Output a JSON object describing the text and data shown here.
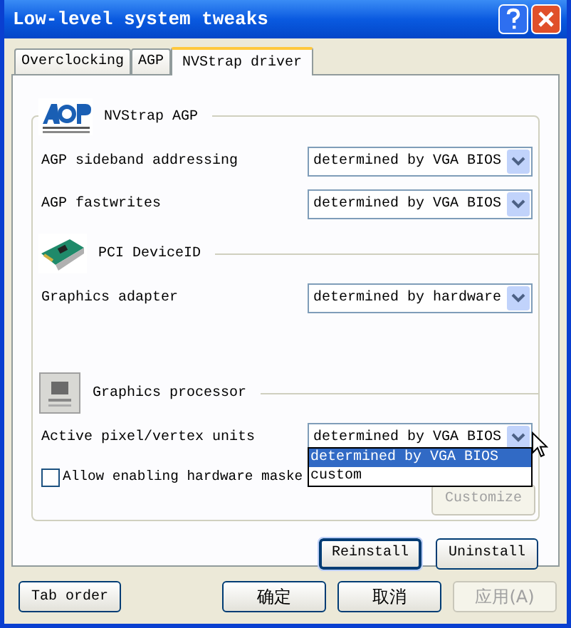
{
  "window": {
    "title": "Low-level system tweaks"
  },
  "tabs": [
    {
      "label": "Overclocking",
      "selected": false
    },
    {
      "label": "AGP",
      "selected": false
    },
    {
      "label": "NVStrap driver",
      "selected": true
    }
  ],
  "sections": [
    {
      "title": "NVStrap AGP",
      "kind": "logo",
      "rows": [
        {
          "label": "AGP sideband addressing",
          "value": "determined by VGA BIOS"
        },
        {
          "label": "AGP fastwrites",
          "value": "determined by VGA BIOS"
        }
      ]
    },
    {
      "title": "PCI DeviceID",
      "kind": "card",
      "rows": [
        {
          "label": "Graphics adapter",
          "value": "determined by hardware"
        }
      ]
    },
    {
      "title": "Graphics processor",
      "kind": "chip",
      "rows": [
        {
          "label": "Active pixel/vertex units",
          "value": "determined by VGA BIOS"
        }
      ]
    }
  ],
  "open_list": [
    {
      "label": "determined by VGA BIOS",
      "selected": true
    },
    {
      "label": "custom",
      "selected": false
    }
  ],
  "checkbox": {
    "label": "Allow enabling hardware maske",
    "checked": false
  },
  "customize_button": {
    "label": "Customize",
    "disabled": true
  },
  "driver_buttons": [
    {
      "label": "Reinstall",
      "default": true
    },
    {
      "label": "Uninstall",
      "default": false
    }
  ],
  "tab_order_button": {
    "label": "Tab order"
  },
  "footer_buttons": [
    {
      "label": "确定",
      "disabled": false
    },
    {
      "label": "取消",
      "disabled": false
    },
    {
      "label": "应用(A)",
      "disabled": true
    }
  ]
}
